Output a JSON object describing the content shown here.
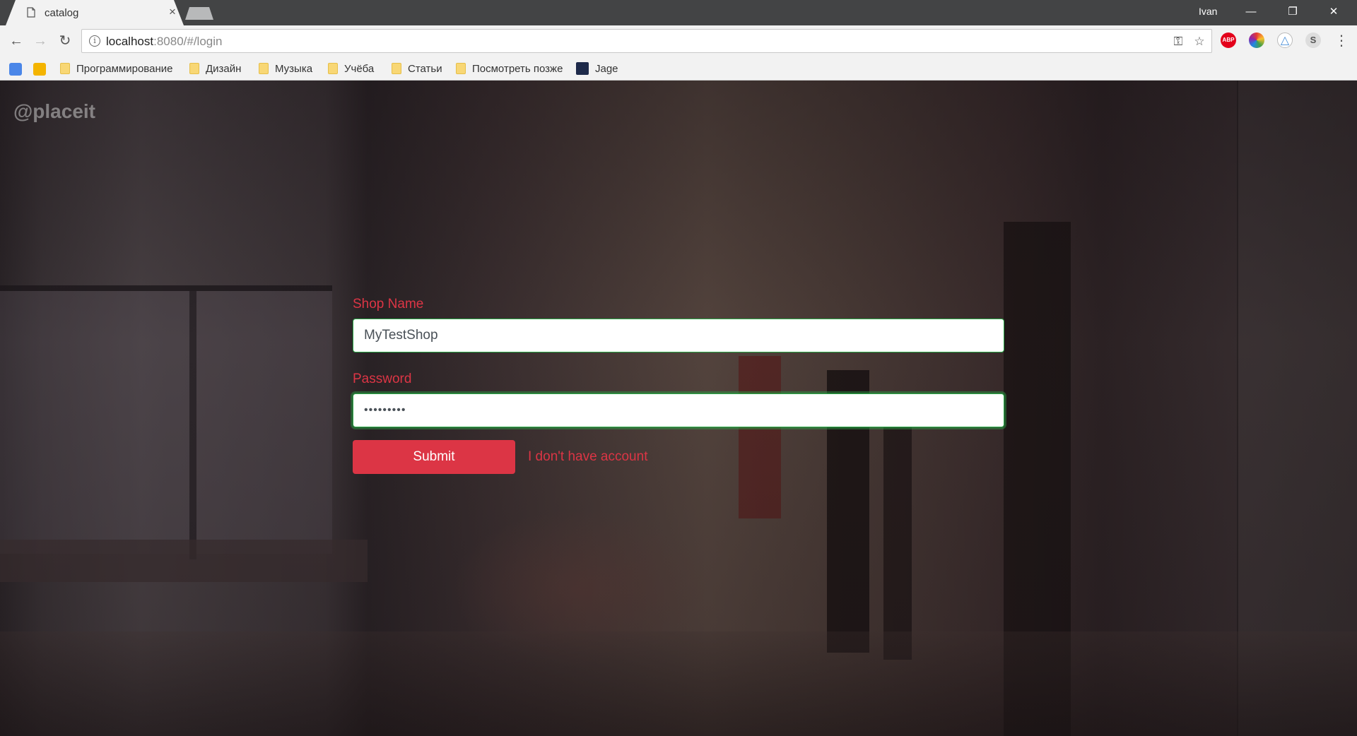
{
  "browser": {
    "tab_title": "catalog",
    "tab_close": "×",
    "user": "Ivan",
    "window_controls": {
      "minimize": "—",
      "restore": "❐",
      "close": "✕"
    },
    "nav": {
      "back": "←",
      "forward": "→",
      "reload": "↻"
    },
    "url_host": "localhost",
    "url_rest": ":8080/#/login",
    "info_glyph": "i",
    "key_icon": "⚿",
    "star_icon": "☆",
    "menu_icon": "⋮",
    "extensions": [
      {
        "name": "abp",
        "label": "ABP",
        "color": "#e3001b"
      },
      {
        "name": "color-picker",
        "label": "",
        "color": "#4caf50"
      },
      {
        "name": "drive",
        "label": "△",
        "color": "#4a90d9"
      },
      {
        "name": "s-ext",
        "label": "S",
        "color": "#d5d5d5"
      }
    ]
  },
  "bookmarks": [
    "Программирование",
    "Дизайн",
    "Музыка",
    "Учёба",
    "Статьи",
    "Посмотреть позже",
    "Jage"
  ],
  "page": {
    "brand": "@placeit",
    "form": {
      "shop_label": "Shop Name",
      "shop_value": "MyTestShop",
      "password_label": "Password",
      "password_value": "•••••••••",
      "submit_label": "Submit",
      "no_account_link": "I don't have account"
    }
  },
  "colors": {
    "accent": "#dc3545",
    "valid": "#28a745"
  }
}
